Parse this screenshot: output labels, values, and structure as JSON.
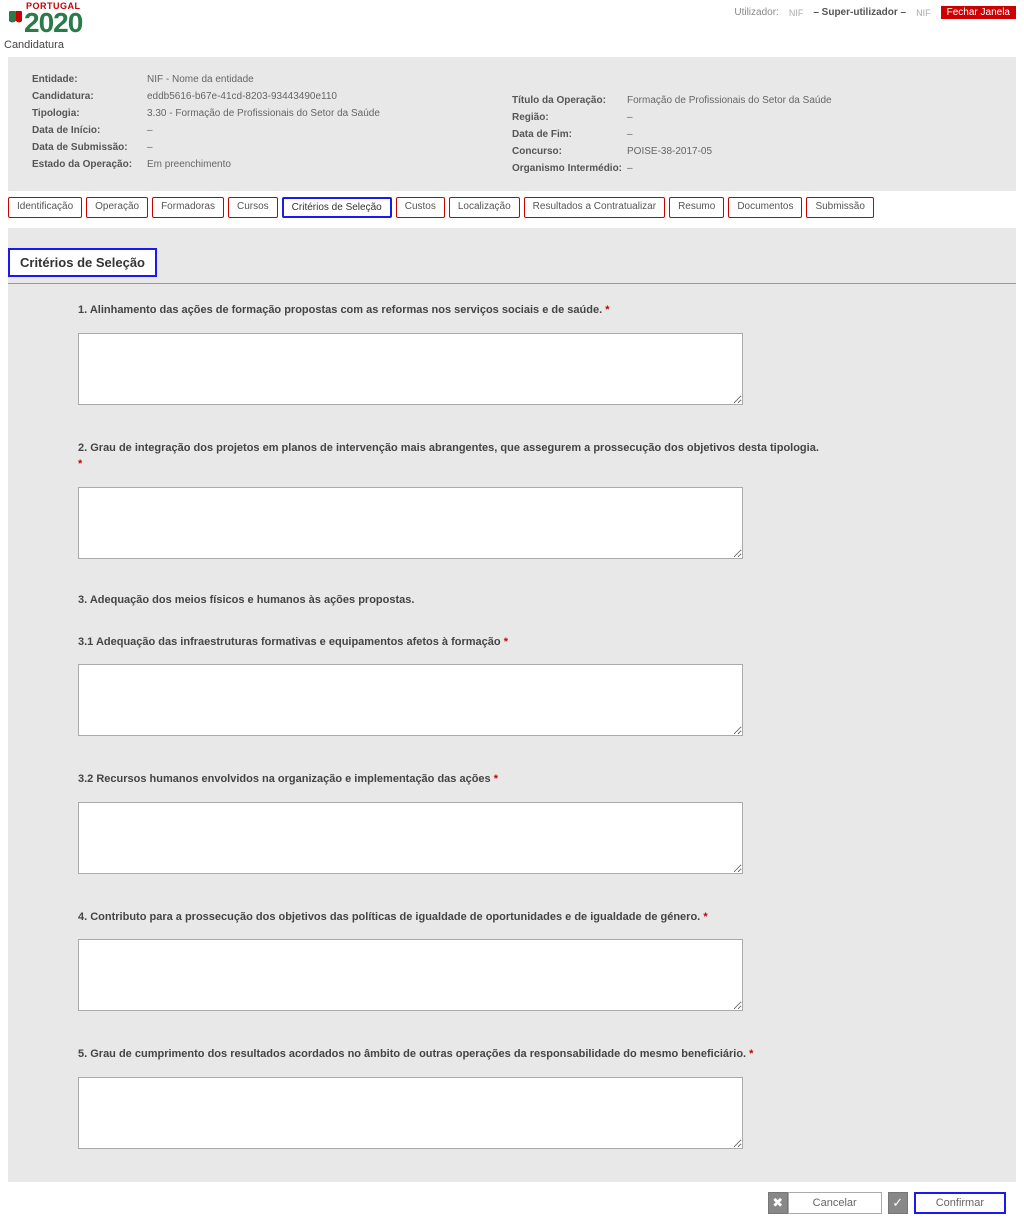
{
  "header": {
    "logo_top": "PORTUGAL",
    "logo_main": "2020",
    "user_label": "Utilizador:",
    "user_nif1": "NIF",
    "user_role": "– Super-utilizador –",
    "user_nif2": "NIF",
    "close_label": "Fechar Janela"
  },
  "breadcrumb": "Candidatura",
  "meta": {
    "left": {
      "entidade_label": "Entidade:",
      "entidade_value": "NIF - Nome da entidade",
      "candidatura_label": "Candidatura:",
      "candidatura_value": "eddb5616-b67e-41cd-8203-93443490e110",
      "tipologia_label": "Tipologia:",
      "tipologia_value": "3.30 - Formação de Profissionais do Setor da Saúde",
      "data_inicio_label": "Data de Início:",
      "data_inicio_value": "–",
      "data_submissao_label": "Data de Submissão:",
      "data_submissao_value": "–",
      "estado_label": "Estado da Operação:",
      "estado_value": "Em preenchimento"
    },
    "right": {
      "titulo_label": "Título da Operação:",
      "titulo_value": "Formação de Profissionais do Setor da Saúde",
      "regiao_label": "Região:",
      "regiao_value": "–",
      "data_fim_label": "Data de Fim:",
      "data_fim_value": "–",
      "concurso_label": "Concurso:",
      "concurso_value": "POISE-38-2017-05",
      "org_label": "Organismo Intermédio:",
      "org_value": "–"
    }
  },
  "tabs": {
    "identificacao": "Identificação",
    "operacao": "Operação",
    "formadoras": "Formadoras",
    "cursos": "Cursos",
    "criterios": "Critérios de Seleção",
    "custos": "Custos",
    "localizacao": "Localização",
    "resultados": "Resultados a Contratualizar",
    "resumo": "Resumo",
    "documentos": "Documentos",
    "submissao": "Submissão"
  },
  "section_title": "Critérios de Seleção",
  "questions": {
    "q1": "1. Alinhamento das ações de formação propostas com as reformas nos serviços sociais e de saúde.",
    "q2": "2. Grau de integração dos projetos em planos de intervenção mais abrangentes, que assegurem a prossecução dos objetivos desta tipologia.",
    "q3h": "3. Adequação dos meios físicos e humanos às ações propostas.",
    "q31": "3.1 Adequação das infraestruturas formativas e equipamentos afetos à formação",
    "q32": "3.2 Recursos humanos envolvidos na organização e implementação das ações",
    "q4": "4. Contributo para a prossecução dos objetivos das políticas de igualdade de oportunidades e de igualdade de género.",
    "q5": "5. Grau de cumprimento dos resultados acordados no âmbito de outras operações da responsabilidade do mesmo beneficiário."
  },
  "footer": {
    "cancel": "Cancelar",
    "confirm": "Confirmar"
  }
}
